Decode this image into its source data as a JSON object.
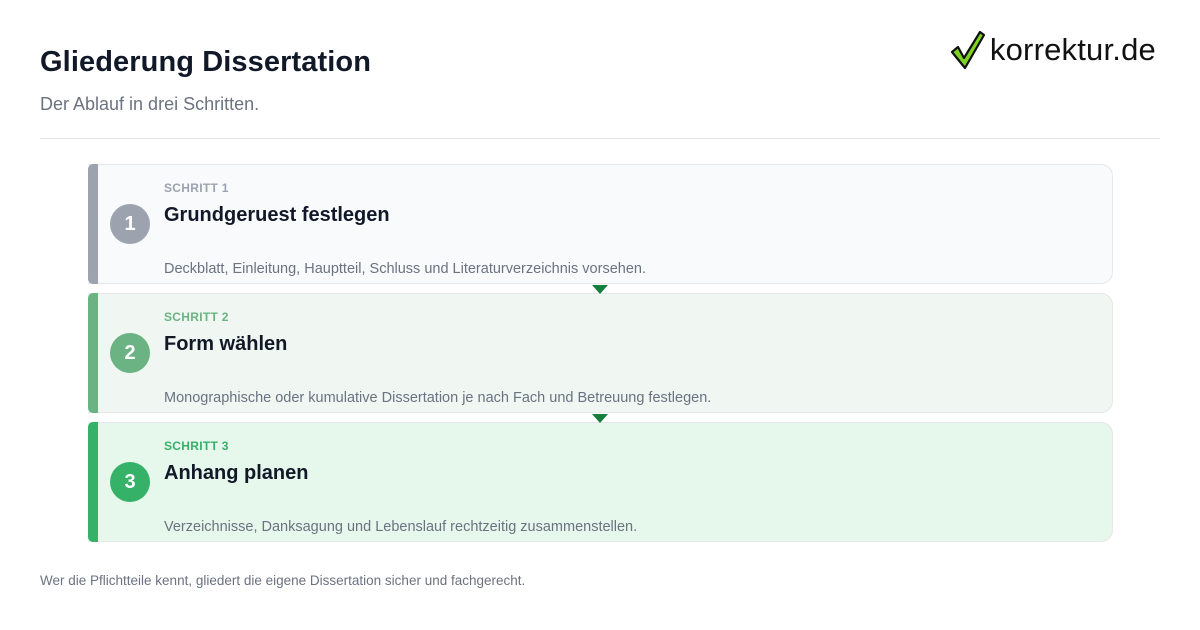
{
  "header": {
    "title": "Gliederung Dissertation",
    "subtitle": "Der Ablauf in drei Schritten."
  },
  "logo": {
    "icon": "checkmark-icon",
    "text": "korrektur.de",
    "check_color": "#7ed321"
  },
  "steps": [
    {
      "kicker": "SCHRITT 1",
      "number": "1",
      "title": "Grundgeruest festlegen",
      "description": "Deckblatt, Einleitung, Hauptteil, Schluss und Literaturverzeichnis vorsehen.",
      "accent": "#9ca3af"
    },
    {
      "kicker": "SCHRITT 2",
      "number": "2",
      "title": "Form wählen",
      "description": "Monographische oder kumulative Dissertation je nach Fach und Betreuung festlegen.",
      "accent": "#6bb382"
    },
    {
      "kicker": "SCHRITT 3",
      "number": "3",
      "title": "Anhang planen",
      "description": "Verzeichnisse, Danksagung und Lebenslauf rechtzeitig zusammenstellen.",
      "accent": "#35b268"
    }
  ],
  "connector_color": "#15803d",
  "footer": {
    "text": "Wer die Pflichtteile kennt, gliedert die eigene Dissertation sicher und fachgerecht."
  }
}
